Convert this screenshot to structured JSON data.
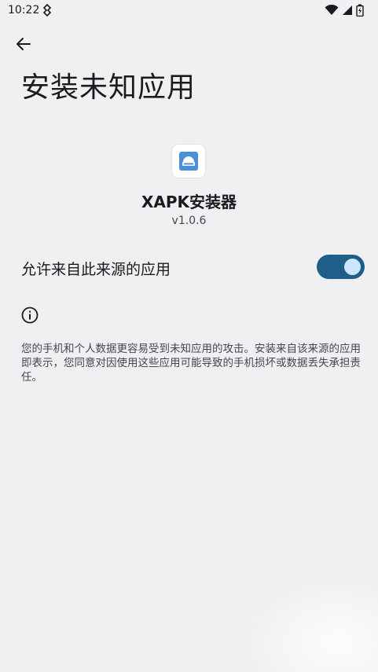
{
  "status_bar": {
    "time": "10:22"
  },
  "header": {
    "title": "安装未知应用"
  },
  "app": {
    "name": "XAPK安装器",
    "version": "v1.0.6"
  },
  "setting": {
    "label": "允许来自此来源的应用",
    "enabled": true
  },
  "warning": {
    "text": "您的手机和个人数据更容易受到未知应用的攻击。安装来自该来源的应用即表示，您同意对因使用这些应用可能导致的手机损坏或数据丢失承担责任。"
  },
  "colors": {
    "background": "#f0f0f3",
    "switch_track": "#1e5e88",
    "switch_thumb": "#cce6ff",
    "app_icon_accent": "#4a8fd8"
  }
}
